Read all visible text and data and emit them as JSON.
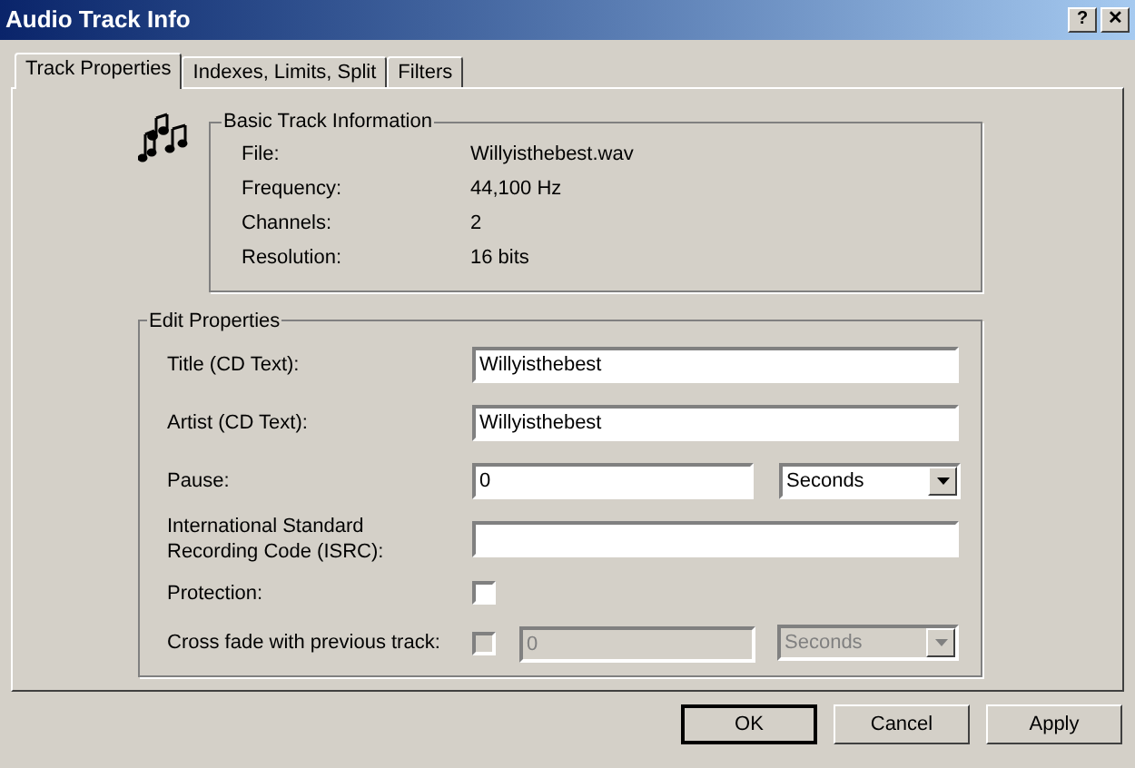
{
  "window": {
    "title": "Audio Track Info",
    "title_buttons": [
      "?",
      "✕"
    ]
  },
  "tabs": [
    {
      "label": "Track Properties",
      "selected": true
    },
    {
      "label": "Indexes, Limits, Split",
      "selected": false
    },
    {
      "label": "Filters",
      "selected": false
    }
  ],
  "basic_info": {
    "title": "Basic Track Information",
    "rows": [
      {
        "label": "File:",
        "value": "Willyisthebest.wav"
      },
      {
        "label": "Frequency:",
        "value": "44,100 Hz"
      },
      {
        "label": "Channels:",
        "value": "2"
      },
      {
        "label": "Resolution:",
        "value": "16 bits"
      }
    ]
  },
  "edit_properties": {
    "title": "Edit Properties",
    "rows": [
      {
        "kind": "text",
        "label": "Title (CD Text):",
        "value": "Willyisthebest"
      },
      {
        "kind": "text",
        "label": "Artist (CD Text):",
        "value": "Willyisthebest"
      },
      {
        "kind": "number_unit",
        "label": "Pause:",
        "value": "0",
        "unit": "Seconds",
        "disabled": false
      },
      {
        "kind": "text",
        "label": "International Standard\nRecording Code (ISRC):"
      },
      {
        "kind": "checkbox",
        "label": "Protection:",
        "checked": false,
        "disabled": false
      },
      {
        "kind": "checkbox_number_unit",
        "label": "Cross fade with previous track:",
        "checked": false,
        "disabled": true,
        "value": "0",
        "unit": "Seconds"
      }
    ]
  },
  "buttons": [
    {
      "label": "OK",
      "default": true
    },
    {
      "label": "Cancel",
      "default": false
    },
    {
      "label": "Apply",
      "default": false
    }
  ]
}
